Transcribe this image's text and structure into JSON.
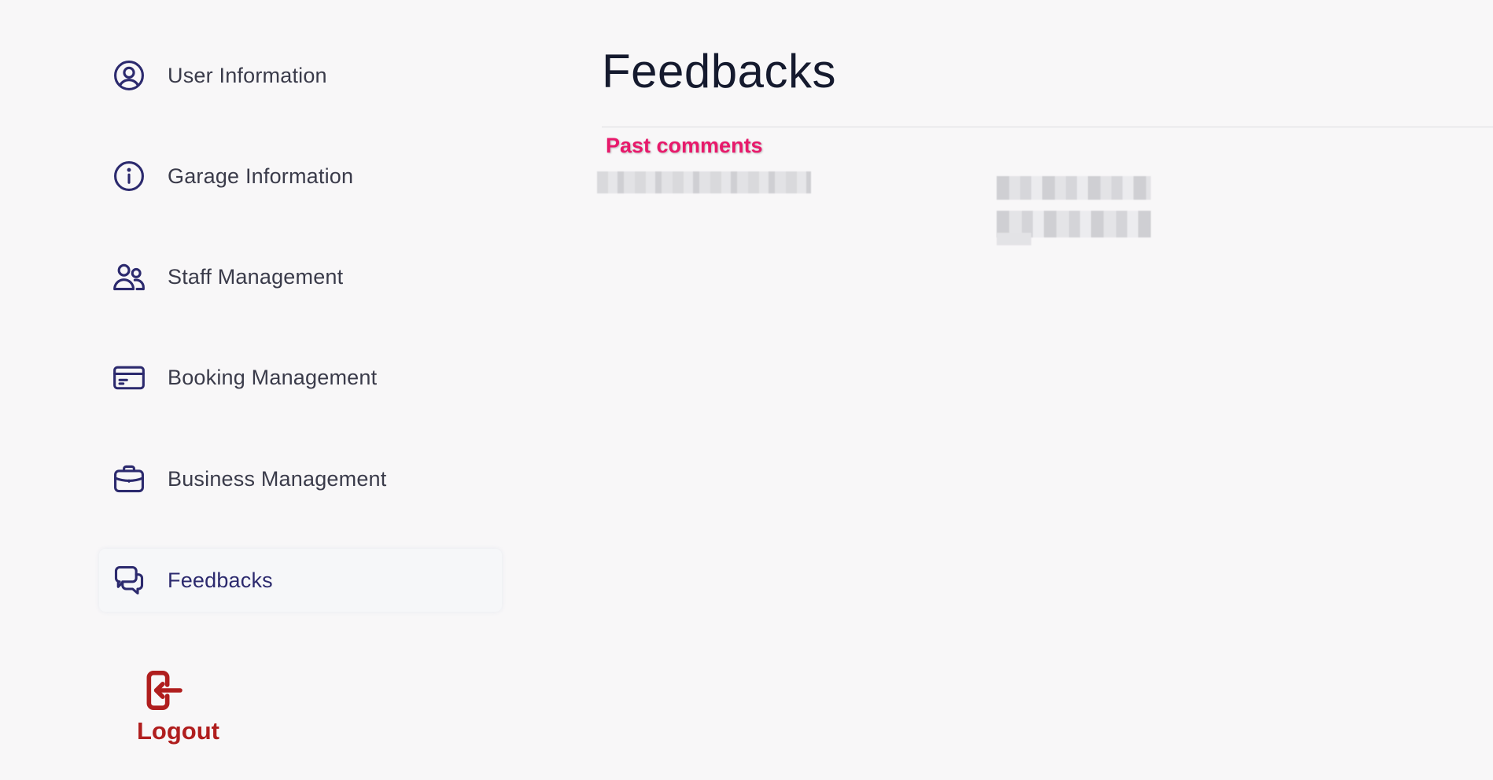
{
  "sidebar": {
    "items": [
      {
        "label": "User Information",
        "icon": "user-circle-icon"
      },
      {
        "label": "Garage Information",
        "icon": "info-circle-icon"
      },
      {
        "label": "Staff Management",
        "icon": "users-icon"
      },
      {
        "label": "Booking Management",
        "icon": "credit-card-icon"
      },
      {
        "label": "Business Management",
        "icon": "briefcase-icon"
      },
      {
        "label": "Feedbacks",
        "icon": "chat-bubbles-icon",
        "active": true
      }
    ],
    "logout": {
      "label": "Logout",
      "icon": "logout-icon"
    }
  },
  "main": {
    "title": "Feedbacks",
    "section_label": "Past comments"
  },
  "colors": {
    "background": "#f8f7f8",
    "icon": "#2c2a6e",
    "text": "#3a3b4a",
    "title": "#151a2e",
    "accent_pink": "#e8196b",
    "logout_red": "#b01e1e"
  }
}
